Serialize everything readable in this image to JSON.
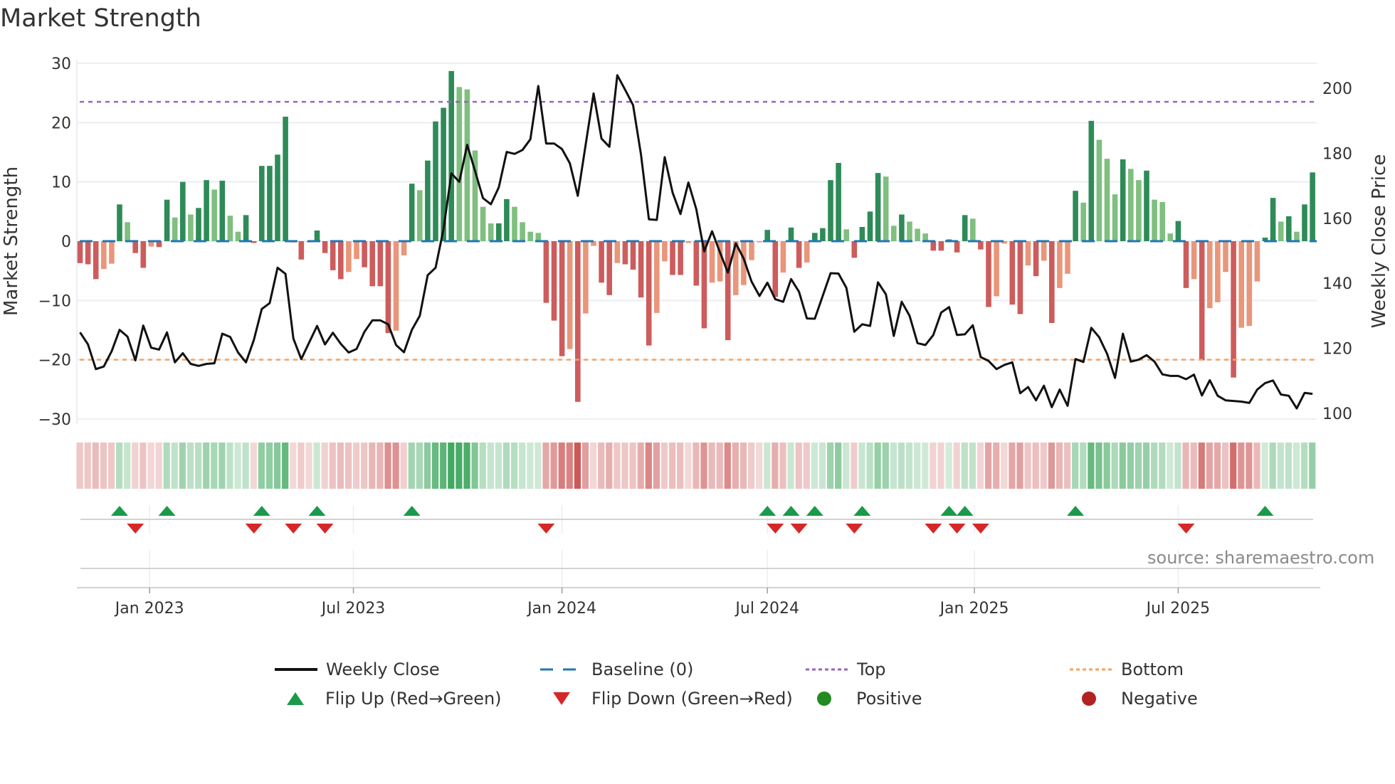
{
  "title": "Market Strength",
  "source": "source: sharemaestro.com",
  "colors": {
    "strong_pos": "#2e8b57",
    "weak_pos": "#7fbf7f",
    "strong_neg": "#cd5c5c",
    "weak_neg": "#e9967a",
    "line": "#111111",
    "baseline": "#1f77b4",
    "top": "#9467bd",
    "bottom": "#f4a261",
    "flip_up": "#1a9a4a",
    "flip_down": "#d62728",
    "positive": "#228b22",
    "negative": "#b22222"
  },
  "legend": [
    {
      "label": "Weekly Close",
      "icon": "solid-line"
    },
    {
      "label": "Baseline (0)",
      "icon": "dashed-line"
    },
    {
      "label": "Top",
      "icon": "dotted-line-purple"
    },
    {
      "label": "Bottom",
      "icon": "dotted-line-orange"
    },
    {
      "label": "Flip Up (Red→Green)",
      "icon": "triangle-up"
    },
    {
      "label": "Flip Down (Green→Red)",
      "icon": "triangle-down"
    },
    {
      "label": "Positive",
      "icon": "circle-green"
    },
    {
      "label": "Negative",
      "icon": "circle-red"
    }
  ],
  "chart_data": {
    "type": "bar+line",
    "title": "Market Strength",
    "ylabel": "Market Strength",
    "y2label": "Weekly Close Price",
    "ylim": [
      -30,
      30
    ],
    "y2lim": [
      100,
      200
    ],
    "yticks": [
      "30",
      "20",
      "10",
      "0",
      "−10",
      "−20",
      "−30"
    ],
    "yticks_values": [
      30,
      20,
      10,
      0,
      -10,
      -20,
      -30
    ],
    "y2ticks": [
      "200",
      "180",
      "160",
      "140",
      "120",
      "100"
    ],
    "y2ticks_values": [
      200,
      180,
      160,
      140,
      120,
      100
    ],
    "top_level": 23.5,
    "bottom_level": -20,
    "baseline": 0,
    "x_unit": "week index",
    "xticks": [
      {
        "label": "Jan 2023",
        "week": 8.8
      },
      {
        "label": "Jul 2023",
        "week": 34.6
      },
      {
        "label": "Jan 2024",
        "week": 61.0
      },
      {
        "label": "Jul 2024",
        "week": 87.0
      },
      {
        "label": "Jan 2025",
        "week": 113.2
      },
      {
        "label": "Jul 2025",
        "week": 139.0
      }
    ],
    "strength": [
      -3.7,
      -3.9,
      -6.4,
      -4.7,
      -3.8,
      6.2,
      3.2,
      -2.0,
      -4.5,
      -0.9,
      -1.0,
      7.0,
      4.0,
      10.0,
      4.5,
      5.6,
      10.3,
      8.7,
      10.2,
      4.3,
      1.6,
      4.4,
      -0.3,
      12.7,
      12.7,
      14.6,
      21.0,
      -0.2,
      -3.1,
      -0.2,
      1.8,
      -2.0,
      -4.9,
      -6.4,
      -5.2,
      -3.0,
      -4.4,
      -7.6,
      -7.6,
      -15.5,
      -15.1,
      -2.4,
      9.7,
      8.6,
      13.6,
      20.2,
      22.5,
      28.7,
      26.0,
      25.6,
      15.3,
      5.8,
      3.0,
      3.0,
      7.1,
      5.8,
      3.2,
      1.6,
      1.4,
      -10.4,
      -13.4,
      -19.4,
      -18.2,
      -27.1,
      -12.2,
      -0.8,
      -7.0,
      -9.1,
      -3.7,
      -3.9,
      -4.8,
      -9.5,
      -17.6,
      -12.1,
      -3.4,
      -5.7,
      -5.7,
      -0.3,
      -7.5,
      -14.7,
      -7.0,
      -6.8,
      -16.7,
      -9.1,
      -7.4,
      -3.2,
      -0.2,
      1.9,
      -9.4,
      -5.3,
      2.3,
      -4.5,
      -3.6,
      1.4,
      2.2,
      10.3,
      13.2,
      2.0,
      -2.8,
      2.4,
      5.0,
      11.5,
      10.9,
      2.6,
      4.5,
      3.3,
      2.1,
      1.3,
      -1.6,
      -1.6,
      0.3,
      -1.9,
      4.4,
      3.8,
      -1.4,
      -11.1,
      -9.3,
      -0.4,
      -10.7,
      -12.3,
      -4.1,
      -5.9,
      -3.3,
      -13.8,
      -7.9,
      -5.5,
      8.5,
      6.5,
      20.3,
      17.1,
      13.9,
      7.9,
      13.8,
      12.2,
      10.3,
      11.9,
      7.0,
      6.6,
      1.3,
      3.4,
      -7.9,
      -6.4,
      -20.1,
      -11.3,
      -10.3,
      -5.2,
      -23.0,
      -14.6,
      -14.3,
      -6.8,
      0.6,
      7.3,
      3.3,
      4.2,
      1.6,
      6.2,
      11.6
    ],
    "weekly_close": [
      124.9,
      121.2,
      113.6,
      114.4,
      119.1,
      125.7,
      123.6,
      116.3,
      127.0,
      120.2,
      119.6,
      124.9,
      115.7,
      118.5,
      115.2,
      114.6,
      115.2,
      115.4,
      124.5,
      123.5,
      118.7,
      115.7,
      122.6,
      132.1,
      133.9,
      144.8,
      142.9,
      123.0,
      116.7,
      121.8,
      126.9,
      121.2,
      124.8,
      121.4,
      118.7,
      119.8,
      125.1,
      128.6,
      128.6,
      127.4,
      121.0,
      118.8,
      125.7,
      130.0,
      142.5,
      144.8,
      156.6,
      173.8,
      171.2,
      182.6,
      174.5,
      166.2,
      164.3,
      169.5,
      180.4,
      179.8,
      181.0,
      184.3,
      200.7,
      183.0,
      183.0,
      181.3,
      176.9,
      166.9,
      182.7,
      198.4,
      184.5,
      182.0,
      204.0,
      199.5,
      194.8,
      179.6,
      159.7,
      159.5,
      178.8,
      167.9,
      161.3,
      171.0,
      162.8,
      149.8,
      156.0,
      149.5,
      143.3,
      152.3,
      147.6,
      140.5,
      136.1,
      140.2,
      135.1,
      134.3,
      141.3,
      137.4,
      129.2,
      129.1,
      136.1,
      143.1,
      143.0,
      138.6,
      125.1,
      127.4,
      126.9,
      140.3,
      136.6,
      123.8,
      134.3,
      130.0,
      121.6,
      121.0,
      124.1,
      131.0,
      132.7,
      124.1,
      124.3,
      127.1,
      117.3,
      116.1,
      113.6,
      114.9,
      115.7,
      106.2,
      108.1,
      104.0,
      108.5,
      101.9,
      107.3,
      102.3,
      116.7,
      115.8,
      126.3,
      123.4,
      118.3,
      110.9,
      124.5,
      115.9,
      116.5,
      117.9,
      115.9,
      112.0,
      111.5,
      111.5,
      110.5,
      111.9,
      105.5,
      110.2,
      105.4,
      104.0,
      103.8,
      103.6,
      103.2,
      107.3,
      109.3,
      110.1,
      105.8,
      105.4,
      101.5,
      106.3,
      106.0
    ],
    "flip_up_weeks": [
      5,
      11,
      23,
      30,
      42,
      87,
      90,
      93,
      99,
      110,
      112,
      126,
      150
    ],
    "flip_down_weeks": [
      7,
      22,
      27,
      31,
      59,
      88,
      91,
      98,
      108,
      111,
      114,
      140
    ]
  }
}
